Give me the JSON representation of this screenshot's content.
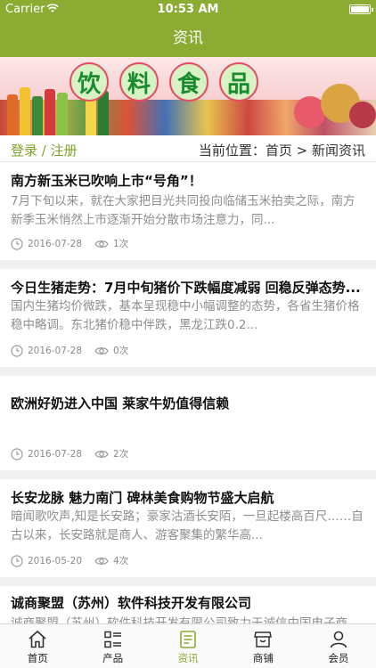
{
  "status_bar": {
    "carrier": "Carrier",
    "time": "10:53 AM"
  },
  "nav": {
    "title": "资讯"
  },
  "banner": {
    "chars": [
      "饮",
      "料",
      "食",
      "品"
    ]
  },
  "breadcrumb": {
    "login": "登录 / 注册",
    "location": "当前位置：首页 > 新闻资讯"
  },
  "news": [
    {
      "title": "南方新玉米已吹响上市“号角”！",
      "summary": "7月下旬以来，就在大家把目光共同投向临储玉米拍卖之际，南方新季玉米悄然上市逐渐开始分散市场注意力，同...",
      "date": "2016-07-28",
      "views": "1次"
    },
    {
      "title": "今日生猪走势：7月中旬猪价下跌幅度减弱 回稳反弹态势...",
      "summary": "国内生猪均价微跌，基本呈现稳中小幅调整的态势，各省生猪价格稳中略调。东北猪价稳中伴跌，黑龙江跌0.2...",
      "date": "2016-07-28",
      "views": "0次"
    },
    {
      "title": "欧洲好奶进入中国 莱家牛奶值得信赖",
      "summary": "",
      "date": "2016-07-28",
      "views": "2次"
    },
    {
      "title": "长安龙脉 魅力南门 碑林美食购物节盛大启航",
      "summary": "暗闻歌吹声,知是长安路；豪家沽酒长安陌，一旦起楼高百尺……自古以来，长安路就是商人、游客聚集的繁华高...",
      "date": "2016-05-20",
      "views": "4次"
    },
    {
      "title": "诚商聚盟（苏州）软件科技开发有限公司",
      "summary": "诚商聚盟（苏州）软件科技开发有限公司致力于诚信中国电子商",
      "date": "",
      "views": ""
    }
  ],
  "tabs": [
    {
      "label": "首页",
      "icon": "home-icon",
      "active": false
    },
    {
      "label": "产品",
      "icon": "list-icon",
      "active": false
    },
    {
      "label": "资讯",
      "icon": "news-icon",
      "active": true
    },
    {
      "label": "商铺",
      "icon": "store-icon",
      "active": false
    },
    {
      "label": "会员",
      "icon": "user-icon",
      "active": false
    }
  ],
  "colors": {
    "brand": "#8bab33",
    "link": "#7ea12b",
    "muted": "#8e8e8e",
    "background": "#f0f0f0"
  }
}
